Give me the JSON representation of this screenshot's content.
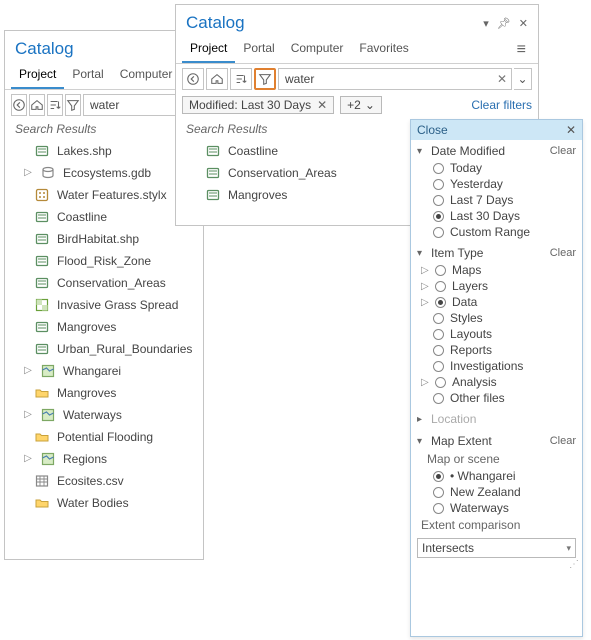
{
  "left_panel": {
    "title": "Catalog",
    "tabs": [
      "Project",
      "Portal",
      "Computer"
    ],
    "active_tab": 0,
    "search_value": "water",
    "section_label": "Search Results",
    "results": [
      {
        "expander": "",
        "icon": "layer",
        "label": "Lakes.shp"
      },
      {
        "expander": "▷",
        "icon": "gdb",
        "label": "Ecosystems.gdb"
      },
      {
        "expander": "",
        "icon": "style",
        "label": "Water Features.stylx"
      },
      {
        "expander": "",
        "icon": "layer",
        "label": "Coastline"
      },
      {
        "expander": "",
        "icon": "layer",
        "label": "BirdHabitat.shp"
      },
      {
        "expander": "",
        "icon": "layer",
        "label": "Flood_Risk_Zone"
      },
      {
        "expander": "",
        "icon": "layer",
        "label": "Conservation_Areas"
      },
      {
        "expander": "",
        "icon": "raster",
        "label": "Invasive Grass Spread"
      },
      {
        "expander": "",
        "icon": "layer",
        "label": "Mangroves"
      },
      {
        "expander": "",
        "icon": "layer",
        "label": "Urban_Rural_Boundaries"
      },
      {
        "expander": "▷",
        "icon": "map",
        "label": "Whangarei"
      },
      {
        "expander": "",
        "icon": "folder",
        "label": "Mangroves"
      },
      {
        "expander": "▷",
        "icon": "map",
        "label": "Waterways"
      },
      {
        "expander": "",
        "icon": "folder",
        "label": "Potential Flooding"
      },
      {
        "expander": "▷",
        "icon": "map",
        "label": "Regions"
      },
      {
        "expander": "",
        "icon": "table",
        "label": "Ecosites.csv"
      },
      {
        "expander": "",
        "icon": "folder",
        "label": "Water Bodies"
      }
    ]
  },
  "right_panel": {
    "title": "Catalog",
    "tabs": [
      "Project",
      "Portal",
      "Computer",
      "Favorites"
    ],
    "active_tab": 0,
    "search_value": "water",
    "chip_label": "Modified: Last 30 Days",
    "chip_plus": "+2",
    "clear_filters_label": "Clear filters",
    "section_label": "Search Results",
    "results": [
      {
        "icon": "layer",
        "label": "Coastline"
      },
      {
        "icon": "layer",
        "label": "Conservation_Areas"
      },
      {
        "icon": "layer",
        "label": "Mangroves"
      }
    ]
  },
  "filter_popup": {
    "close_label": "Close",
    "sections": {
      "date_modified": {
        "title": "Date Modified",
        "clear": "Clear",
        "options": [
          "Today",
          "Yesterday",
          "Last 7 Days",
          "Last 30 Days",
          "Custom Range"
        ],
        "selected": 3
      },
      "item_type": {
        "title": "Item Type",
        "clear": "Clear",
        "options": [
          {
            "label": "Maps",
            "expander": true
          },
          {
            "label": "Layers",
            "expander": true
          },
          {
            "label": "Data",
            "expander": true
          },
          {
            "label": "Styles",
            "expander": false
          },
          {
            "label": "Layouts",
            "expander": false
          },
          {
            "label": "Reports",
            "expander": false
          },
          {
            "label": "Investigations",
            "expander": false
          },
          {
            "label": "Analysis",
            "expander": true
          },
          {
            "label": "Other files",
            "expander": false
          }
        ],
        "selected": 2
      },
      "location": {
        "title": "Location"
      },
      "map_extent": {
        "title": "Map Extent",
        "clear": "Clear",
        "subhead": "Map or scene",
        "options": [
          "Whangarei",
          "New Zealand",
          "Waterways"
        ],
        "selected": 0,
        "extent_label": "Extent comparison",
        "extent_value": "Intersects"
      }
    }
  }
}
